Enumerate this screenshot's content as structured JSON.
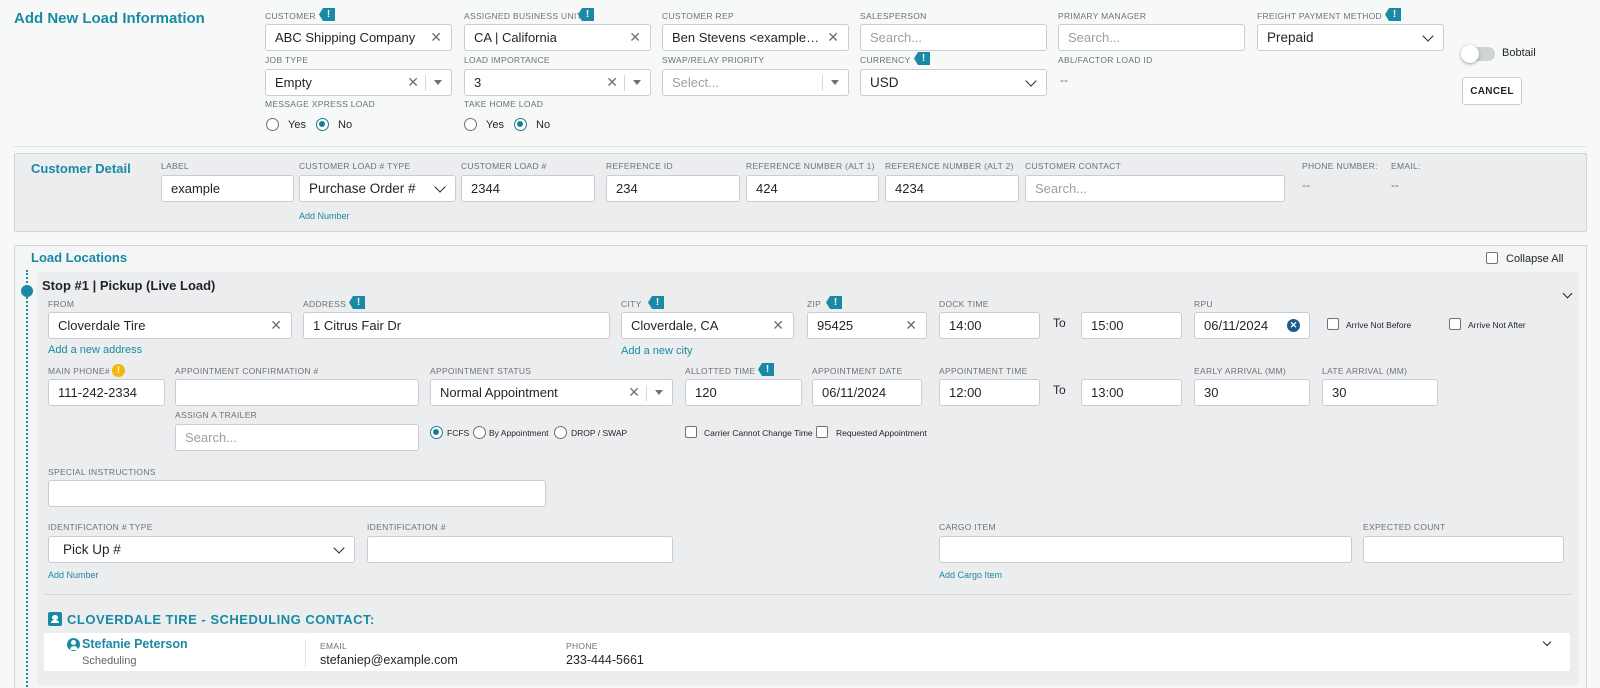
{
  "header": {
    "title": "Add New Load Information",
    "bobtail_label": "Bobtail",
    "cancel_label": "CANCEL"
  },
  "load": {
    "customer": {
      "label": "CUSTOMER",
      "value": "ABC Shipping Company"
    },
    "business_unit": {
      "label": "ASSIGNED BUSINESS UNIT",
      "value": "CA | California"
    },
    "customer_rep": {
      "label": "CUSTOMER REP",
      "value": "Ben Stevens <examplecarrier@example.com>"
    },
    "salesperson": {
      "label": "SALESPERSON",
      "placeholder": "Search..."
    },
    "primary_manager": {
      "label": "PRIMARY MANAGER",
      "placeholder": "Search..."
    },
    "freight_payment": {
      "label": "FREIGHT PAYMENT METHOD",
      "value": "Prepaid"
    },
    "job_type": {
      "label": "JOB TYPE",
      "value": "Empty"
    },
    "load_importance": {
      "label": "LOAD IMPORTANCE",
      "value": "3"
    },
    "swap_priority": {
      "label": "SWAP/RELAY PRIORITY",
      "placeholder": "Select..."
    },
    "currency": {
      "label": "CURRENCY",
      "value": "USD"
    },
    "abl_factor": {
      "label": "ABL/FACTOR LOAD ID",
      "value": "--"
    },
    "message_xpress": {
      "label": "MESSAGE XPRESS LOAD",
      "yes": "Yes",
      "no": "No",
      "selected": "No"
    },
    "take_home": {
      "label": "TAKE HOME LOAD",
      "yes": "Yes",
      "no": "No",
      "selected": "No"
    }
  },
  "customer_detail": {
    "title": "Customer Detail",
    "label_field": {
      "label": "LABEL",
      "value": "example"
    },
    "load_num_type": {
      "label": "CUSTOMER LOAD # TYPE",
      "value": "Purchase Order #"
    },
    "add_number": "Add Number",
    "customer_load_num": {
      "label": "CUSTOMER LOAD #",
      "value": "2344"
    },
    "reference_id": {
      "label": "REFERENCE ID",
      "value": "234"
    },
    "ref_alt1": {
      "label": "REFERENCE NUMBER (ALT 1)",
      "value": "424"
    },
    "ref_alt2": {
      "label": "REFERENCE NUMBER (ALT 2)",
      "value": "4234"
    },
    "customer_contact": {
      "label": "CUSTOMER CONTACT",
      "placeholder": "Search..."
    },
    "phone": {
      "label": "PHONE NUMBER:",
      "value": "--"
    },
    "email": {
      "label": "EMAIL:",
      "value": "--"
    }
  },
  "locations": {
    "title": "Load Locations",
    "collapse_all": "Collapse All",
    "stop": {
      "title": "Stop #1 | Pickup (Live Load)",
      "from": {
        "label": "FROM",
        "value": "Cloverdale Tire"
      },
      "add_address": "Add a new address",
      "address": {
        "label": "ADDRESS",
        "value": "1 Citrus Fair Dr"
      },
      "city": {
        "label": "CITY",
        "value": "Cloverdale, CA"
      },
      "add_city": "Add a new city",
      "zip": {
        "label": "ZIP",
        "value": "95425"
      },
      "dock_time": {
        "label": "DOCK TIME",
        "from": "14:00",
        "to": "15:00"
      },
      "to_label": "To",
      "rpu": {
        "label": "RPU",
        "value": "06/11/2024"
      },
      "arrive_not_before": "Arrive Not Before",
      "arrive_not_after": "Arrive Not After",
      "main_phone": {
        "label": "MAIN PHONE#",
        "value": "111-242-2334"
      },
      "appt_confirmation": {
        "label": "APPOINTMENT CONFIRMATION #",
        "value": ""
      },
      "appt_status": {
        "label": "APPOINTMENT STATUS",
        "value": "Normal Appointment"
      },
      "allotted_time": {
        "label": "ALLOTTED TIME",
        "value": "120"
      },
      "appt_date": {
        "label": "APPOINTMENT DATE",
        "value": "06/11/2024"
      },
      "appt_time": {
        "label": "APPOINTMENT TIME",
        "from": "12:00",
        "to": "13:00"
      },
      "early_arrival": {
        "label": "EARLY ARRIVAL (MM)",
        "value": "30"
      },
      "late_arrival": {
        "label": "LATE ARRIVAL (MM)",
        "value": "30"
      },
      "assign_trailer": {
        "label": "ASSIGN A TRAILER",
        "placeholder": "Search..."
      },
      "appt_mode": {
        "fcfs": "FCFS",
        "by_appt": "By Appointment",
        "drop_swap": "DROP / SWAP",
        "selected": "FCFS"
      },
      "carrier_cannot_change": "Carrier Cannot Change Time",
      "requested_appt": "Requested Appointment",
      "special_instructions": {
        "label": "SPECIAL INSTRUCTIONS",
        "value": ""
      },
      "id_type": {
        "label": "IDENTIFICATION # TYPE",
        "value": "Pick Up #"
      },
      "add_number": "Add Number",
      "id_number": {
        "label": "IDENTIFICATION #",
        "value": ""
      },
      "cargo_item": {
        "label": "CARGO ITEM",
        "value": ""
      },
      "add_cargo": "Add Cargo Item",
      "expected_count": {
        "label": "EXPECTED COUNT",
        "value": ""
      },
      "contact_heading": "CLOVERDALE TIRE - SCHEDULING CONTACT:",
      "contact": {
        "name": "Stefanie Peterson",
        "role": "Scheduling",
        "email_label": "EMAIL",
        "email": "stefaniep@example.com",
        "phone_label": "PHONE",
        "phone": "233-444-5661"
      }
    }
  },
  "colors": {
    "accent": "#1a8aa4",
    "radio": "#1a7f8e",
    "warning": "#f5b50a"
  }
}
